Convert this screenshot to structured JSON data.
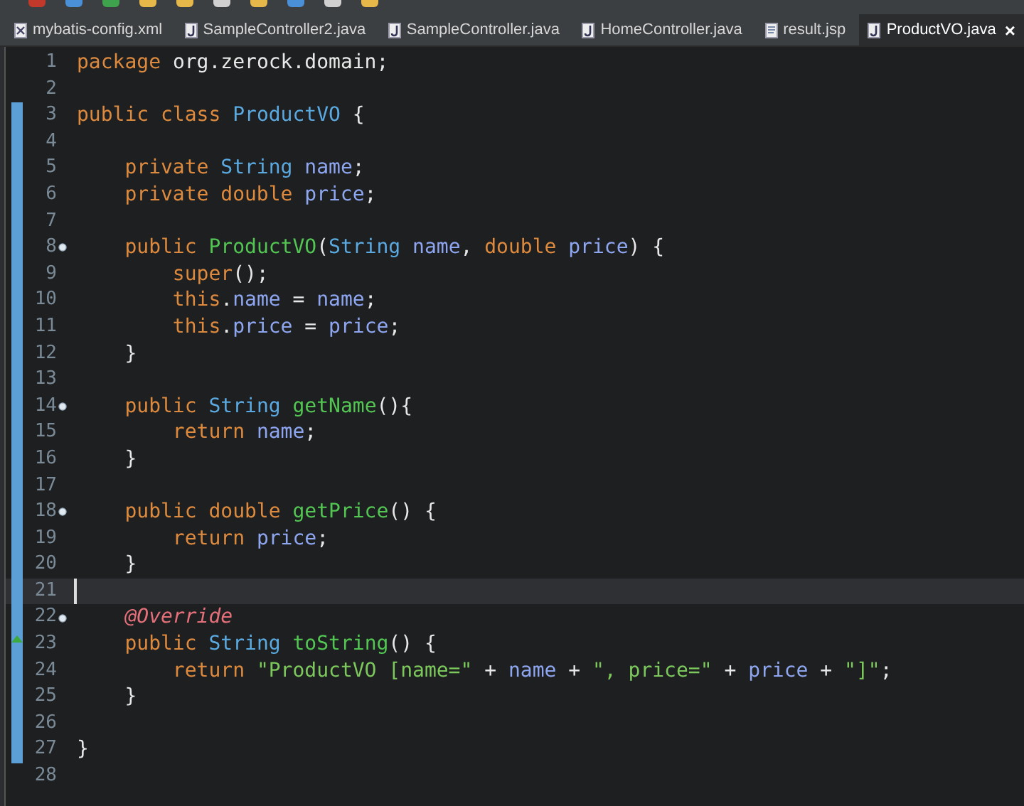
{
  "tabs": [
    {
      "label": "mybatis-config.xml",
      "kind": "xml",
      "selected": false
    },
    {
      "label": "SampleController2.java",
      "kind": "java",
      "selected": false
    },
    {
      "label": "SampleController.java",
      "kind": "java",
      "selected": false
    },
    {
      "label": "HomeController.java",
      "kind": "java",
      "selected": false
    },
    {
      "label": "result.jsp",
      "kind": "jsp",
      "selected": false
    },
    {
      "label": "ProductVO.java",
      "kind": "java",
      "selected": true,
      "close": "×"
    }
  ],
  "lines": [
    {
      "number": "1",
      "changed": false,
      "current": false,
      "tokens": [
        {
          "kind": "keyword",
          "text": "package"
        },
        {
          "kind": "plain",
          "text": " org.zerock.domain;"
        }
      ]
    },
    {
      "number": "2",
      "changed": false,
      "current": false
    },
    {
      "number": "3",
      "changed": true,
      "current": false,
      "tokens": [
        {
          "kind": "keyword",
          "text": "public class"
        },
        {
          "kind": "type",
          "text": " ProductVO"
        },
        {
          "kind": "plain",
          "text": " {"
        }
      ]
    },
    {
      "number": "4",
      "changed": true,
      "current": false
    },
    {
      "number": "5",
      "changed": true,
      "current": false,
      "tokens": [
        {
          "kind": "keyword",
          "text": "    private"
        },
        {
          "kind": "type",
          "text": " String"
        },
        {
          "kind": "field",
          "text": " name"
        },
        {
          "kind": "plain",
          "text": ";"
        }
      ]
    },
    {
      "number": "6",
      "changed": true,
      "current": false,
      "tokens": [
        {
          "kind": "keyword",
          "text": "    private double"
        },
        {
          "kind": "field",
          "text": " price"
        },
        {
          "kind": "plain",
          "text": ";"
        }
      ]
    },
    {
      "number": "7",
      "changed": true,
      "current": false
    },
    {
      "number": "8",
      "changed": true,
      "fold": true,
      "current": false,
      "tokens": [
        {
          "kind": "keyword",
          "text": "    public"
        },
        {
          "kind": "method",
          "text": " ProductVO"
        },
        {
          "kind": "plain",
          "text": "("
        },
        {
          "kind": "type",
          "text": "String"
        },
        {
          "kind": "param",
          "text": " name"
        },
        {
          "kind": "plain",
          "text": ", "
        },
        {
          "kind": "keyword",
          "text": "double"
        },
        {
          "kind": "param",
          "text": " price"
        },
        {
          "kind": "plain",
          "text": ") {"
        }
      ]
    },
    {
      "number": "9",
      "changed": true,
      "current": false,
      "tokens": [
        {
          "kind": "keyword",
          "text": "        super"
        },
        {
          "kind": "plain",
          "text": "();"
        }
      ]
    },
    {
      "number": "10",
      "changed": true,
      "current": false,
      "tokens": [
        {
          "kind": "keyword",
          "text": "        this"
        },
        {
          "kind": "plain",
          "text": "."
        },
        {
          "kind": "field",
          "text": "name"
        },
        {
          "kind": "plain",
          "text": " = "
        },
        {
          "kind": "param",
          "text": "name"
        },
        {
          "kind": "plain",
          "text": ";"
        }
      ]
    },
    {
      "number": "11",
      "changed": true,
      "current": false,
      "tokens": [
        {
          "kind": "keyword",
          "text": "        this"
        },
        {
          "kind": "plain",
          "text": "."
        },
        {
          "kind": "field",
          "text": "price"
        },
        {
          "kind": "plain",
          "text": " = "
        },
        {
          "kind": "param",
          "text": "price"
        },
        {
          "kind": "plain",
          "text": ";"
        }
      ]
    },
    {
      "number": "12",
      "changed": true,
      "current": false,
      "tokens": [
        {
          "kind": "plain",
          "text": "    }"
        }
      ]
    },
    {
      "number": "13",
      "changed": true,
      "current": false
    },
    {
      "number": "14",
      "changed": true,
      "fold": true,
      "current": false,
      "tokens": [
        {
          "kind": "keyword",
          "text": "    public"
        },
        {
          "kind": "type",
          "text": " String"
        },
        {
          "kind": "method",
          "text": " getName"
        },
        {
          "kind": "plain",
          "text": "(){"
        }
      ]
    },
    {
      "number": "15",
      "changed": true,
      "current": false,
      "tokens": [
        {
          "kind": "keyword",
          "text": "        return"
        },
        {
          "kind": "field",
          "text": " name"
        },
        {
          "kind": "plain",
          "text": ";"
        }
      ]
    },
    {
      "number": "16",
      "changed": true,
      "current": false,
      "tokens": [
        {
          "kind": "plain",
          "text": "    }"
        }
      ]
    },
    {
      "number": "17",
      "changed": true,
      "current": false
    },
    {
      "number": "18",
      "changed": true,
      "fold": true,
      "current": false,
      "tokens": [
        {
          "kind": "keyword",
          "text": "    public double"
        },
        {
          "kind": "method",
          "text": " getPrice"
        },
        {
          "kind": "plain",
          "text": "() {"
        }
      ]
    },
    {
      "number": "19",
      "changed": true,
      "current": false,
      "tokens": [
        {
          "kind": "keyword",
          "text": "        return"
        },
        {
          "kind": "field",
          "text": " price"
        },
        {
          "kind": "plain",
          "text": ";"
        }
      ]
    },
    {
      "number": "20",
      "changed": true,
      "current": false,
      "tokens": [
        {
          "kind": "plain",
          "text": "    }"
        }
      ]
    },
    {
      "number": "21",
      "changed": true,
      "current": true
    },
    {
      "number": "22",
      "changed": true,
      "fold": true,
      "current": false,
      "tokens": [
        {
          "kind": "annotation",
          "text": "    @Override"
        }
      ]
    },
    {
      "number": "23",
      "changed": true,
      "override": true,
      "current": false,
      "tokens": [
        {
          "kind": "keyword",
          "text": "    public"
        },
        {
          "kind": "type",
          "text": " String"
        },
        {
          "kind": "method",
          "text": " toString"
        },
        {
          "kind": "plain",
          "text": "() {"
        }
      ]
    },
    {
      "number": "24",
      "changed": true,
      "current": false,
      "tokens": [
        {
          "kind": "keyword",
          "text": "        return"
        },
        {
          "kind": "string",
          "text": " \"ProductVO [name=\""
        },
        {
          "kind": "plain",
          "text": " + "
        },
        {
          "kind": "field",
          "text": "name"
        },
        {
          "kind": "plain",
          "text": " + "
        },
        {
          "kind": "string",
          "text": "\", price=\""
        },
        {
          "kind": "plain",
          "text": " + "
        },
        {
          "kind": "field",
          "text": "price"
        },
        {
          "kind": "plain",
          "text": " + "
        },
        {
          "kind": "string",
          "text": "\"]\""
        },
        {
          "kind": "plain",
          "text": ";"
        }
      ]
    },
    {
      "number": "25",
      "changed": true,
      "current": false,
      "tokens": [
        {
          "kind": "plain",
          "text": "    }"
        }
      ]
    },
    {
      "number": "26",
      "changed": true,
      "current": false
    },
    {
      "number": "27",
      "changed": true,
      "current": false,
      "tokens": [
        {
          "kind": "plain",
          "text": "}"
        }
      ]
    },
    {
      "number": "28",
      "changed": false,
      "current": false
    }
  ]
}
